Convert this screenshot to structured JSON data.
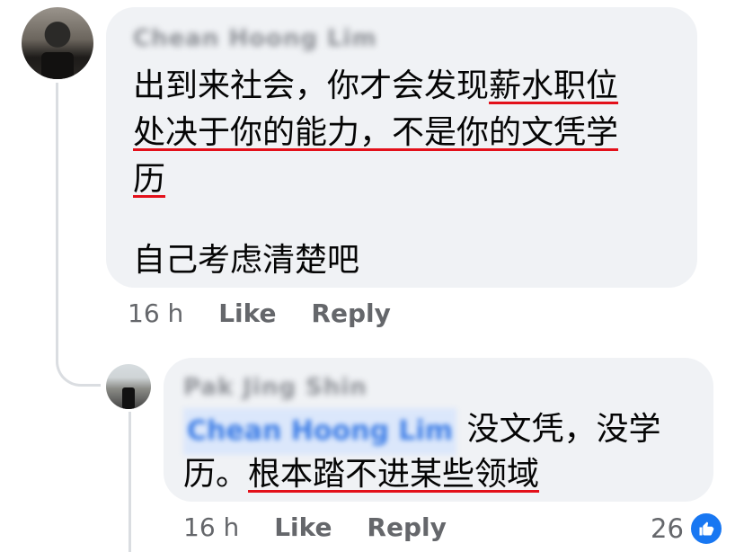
{
  "comment1": {
    "author": "Chean Hoong Lim",
    "lines": [
      {
        "plain": "出到来社会，你才会发现",
        "underlined": "薪水职位"
      },
      {
        "plain": "",
        "underlined": "处决于你的能力，不是你的文凭学"
      },
      {
        "plain": "",
        "underlined": "历"
      },
      {
        "plain": "",
        "underlined": ""
      },
      {
        "plain": "自己考虑清楚吧",
        "underlined": ""
      }
    ],
    "time": "16 h",
    "like_label": "Like",
    "reply_label": "Reply"
  },
  "comment2": {
    "author": "Pak Jing Shin",
    "mention": "Chean Hoong Lim",
    "line1_rest": " 没文凭，没学",
    "line2_plain": "历。",
    "line2_underlined": "根本踏不进某些领域",
    "time": "16 h",
    "like_label": "Like",
    "reply_label": "Reply",
    "reaction_count": "26"
  },
  "icons": {
    "reaction": "like-thumb-icon",
    "accent": "#1877f2",
    "underline_color": "#e3101a"
  }
}
